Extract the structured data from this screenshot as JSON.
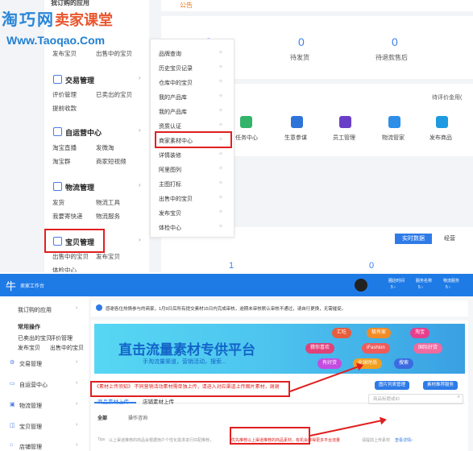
{
  "watermark": {
    "part1": "淘巧网",
    "part2": "卖家课堂",
    "url": "Www.Taoqao.Com"
  },
  "top": {
    "header_clipped": "我订购的应用",
    "announcement_tag": "公告",
    "sidebar": {
      "top_links": [
        "发布宝贝",
        "出售中的宝贝"
      ],
      "sections": [
        {
          "title": "交易管理",
          "links": [
            "评价管理",
            "已卖出的宝贝",
            "提前收款"
          ]
        },
        {
          "title": "自运营中心",
          "links": [
            "淘宝直播",
            "发微淘",
            "淘宝群",
            "商家短视频"
          ]
        },
        {
          "title": "物流管理",
          "links": [
            "发货",
            "物流工具",
            "我要寄快递",
            "物流服务"
          ]
        },
        {
          "title": "宝贝管理",
          "links": [
            "出售中的宝贝",
            "发布宝贝",
            "体检中心"
          ]
        }
      ]
    },
    "flyout": [
      "品牌查询",
      "历史宝贝记录",
      "仓库中的宝贝",
      "我的产品库",
      "我的产品库",
      "资质认证",
      "商家素材中心",
      "详情装修",
      "阿里图列",
      "主图打标",
      "出售中的宝贝",
      "发布宝贝",
      "体检中心"
    ],
    "stats": [
      {
        "value": "0",
        "label": ""
      },
      {
        "value": "0",
        "label": "待发货"
      },
      {
        "value": "0",
        "label": "待退款售后"
      }
    ],
    "pending_eval": "待评价金用(",
    "quick": [
      "任务中心",
      "生意参谋",
      "员工管理",
      "物流管家",
      "发布商品"
    ],
    "realtime_tab": "实时数据",
    "realtime_tab2": "经营",
    "bottom_values": [
      "1",
      "0"
    ]
  },
  "bottom": {
    "app_title": "卖家工作台",
    "header_stats": [
      {
        "label": "圈店时间",
        "value": "5 ›"
      },
      {
        "label": "服务名称",
        "value": "5 ›"
      },
      {
        "label": "物流服务",
        "value": "5 ›"
      }
    ],
    "sidebar": {
      "my_apps": "我订购的应用",
      "common_ops": "常用操作",
      "common_links": [
        "已卖出的宝贝",
        "评价管理",
        "发布宝贝",
        "出售中的宝贝"
      ],
      "sections": [
        "交易管理",
        "自运营中心",
        "物流管理",
        "宝贝管理",
        "店铺管理"
      ]
    },
    "notice": "感谢各位热情参与的商家，1月9日后所有提交素材15日内完成审核，逾期未审核默认审核不通过，请自行更换，无需催促。",
    "banner": {
      "title": "直击流量素材专供平台",
      "subtitle": "手淘流量渠道，营销活动，搜索...",
      "pills": [
        "汇吃",
        "极有家",
        "淘宝",
        "猜你喜欢",
        "iFashion",
        "国际好货",
        "有好货",
        "全球时尚",
        "搜索"
      ]
    },
    "red_note": "《素材上传须知》 不同营销活动素材需单独上传，请进入对应渠道上传图片素材，谢谢",
    "btn_picture": "图片列表管理",
    "btn_material": "素材推荐服务",
    "tabs": [
      "商品素材上传",
      "店铺素材上传"
    ],
    "search_placeholder": "商品标题或ID",
    "filter_all": "全部",
    "filter_ops": "操作咨询",
    "tips_label": "Tips",
    "tips": "以上渠道推荐的商品会根据用户个性化需求进行匹配推荐，",
    "tips_red": "优先推荐以上渠道推荐的商品素材，有机会获得更多平台流量",
    "tips_tail": "请提前上传素材",
    "tips_link": "查看详情›"
  }
}
